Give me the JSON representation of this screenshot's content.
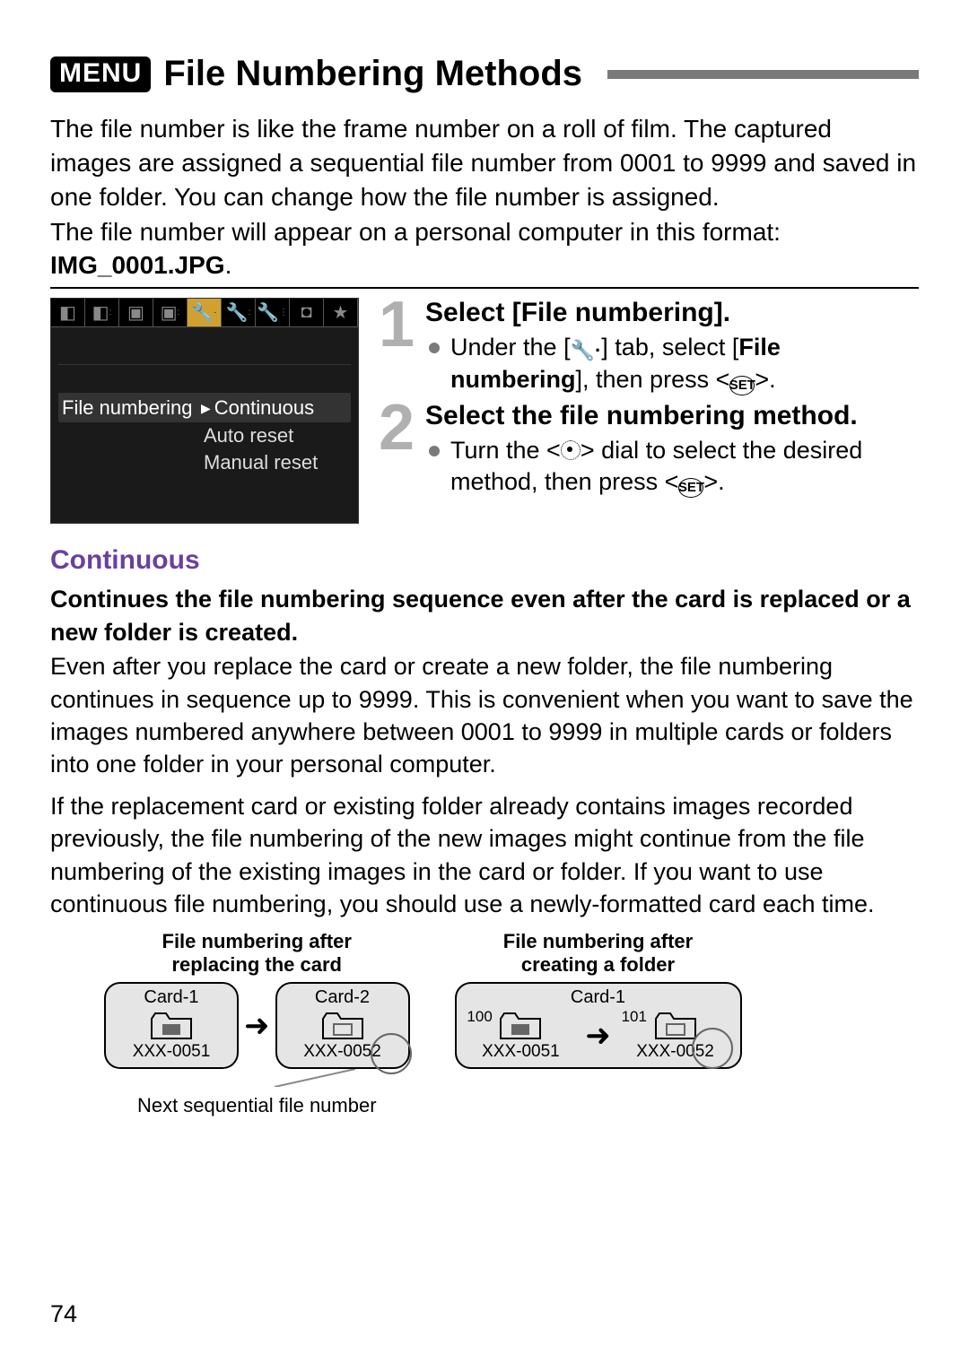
{
  "header": {
    "menu_label": "MENU",
    "title": "File Numbering Methods"
  },
  "intro": {
    "p1": "The file number is like the frame number on a roll of film. The captured images are assigned a sequential file number from 0001 to 9999 and saved in one folder. You can change how the file number is assigned.",
    "p2": "The file number will appear on a personal computer in this format:",
    "example": "IMG_0001.JPG",
    "period": "."
  },
  "lcd": {
    "row_label": "File numbering",
    "options": [
      "Continuous",
      "Auto reset",
      "Manual reset"
    ]
  },
  "steps": [
    {
      "num": "1",
      "title": "Select [File numbering].",
      "bullet_pre": "Under the [",
      "bullet_mid1": "] tab, select [",
      "bullet_bold1": "File numbering",
      "bullet_mid2": "], then press <",
      "bullet_post": ">."
    },
    {
      "num": "2",
      "title": "Select the file numbering method.",
      "bullet_pre": "Turn the <",
      "bullet_mid": "> dial to select the desired method, then press <",
      "bullet_post": ">."
    }
  ],
  "section": {
    "heading": "Continuous",
    "lead": "Continues the file numbering sequence even after the card is replaced or a new folder is created.",
    "p1": "Even after you replace the card or create a new folder, the file numbering continues in sequence up to 9999. This is convenient when you want to save the images numbered anywhere between 0001 to 9999 in multiple cards or folders into one folder in your personal computer.",
    "p2": "If the replacement card or existing folder already contains images recorded previously, the file numbering of the new images might continue from the file numbering of the existing images in the card or folder. If you want to use continuous file numbering, you should use a newly-formatted card each time."
  },
  "diagrams": {
    "left": {
      "title1": "File numbering after",
      "title2": "replacing the card",
      "card1": "Card-1",
      "card2": "Card-2",
      "x1": "XXX-0051",
      "x2": "XXX-0052",
      "caption": "Next sequential file number"
    },
    "right": {
      "title1": "File numbering after",
      "title2": "creating a folder",
      "card1": "Card-1",
      "f1": "100",
      "f2": "101",
      "x1": "XXX-0051",
      "x2": "XXX-0052"
    }
  },
  "page_number": "74"
}
